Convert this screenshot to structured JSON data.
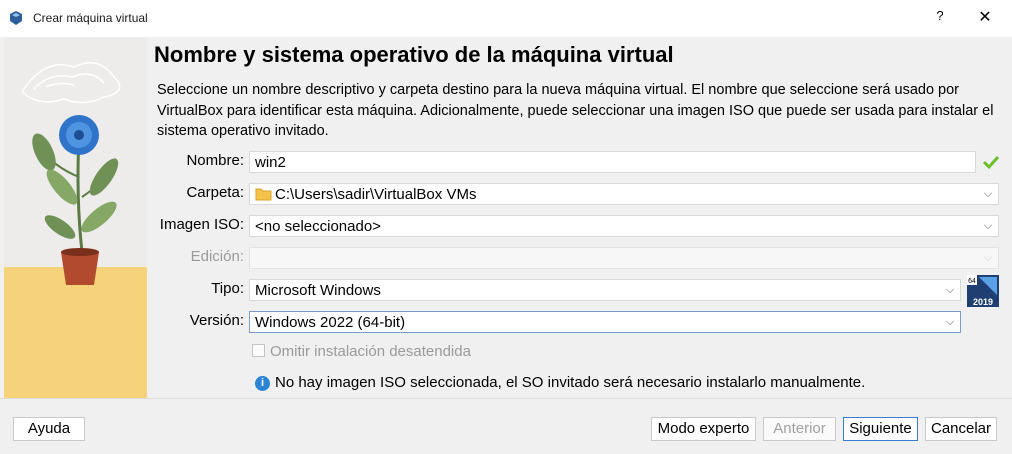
{
  "window": {
    "title": "Crear máquina virtual",
    "help": "?",
    "close": "✕"
  },
  "heading": "Nombre y sistema operativo de la máquina virtual",
  "description": "Seleccione un nombre descriptivo y carpeta destino para la nueva máquina virtual. El nombre que seleccione será usado por VirtualBox para identificar esta máquina. Adicionalmente, puede seleccionar una imagen ISO que puede ser usada para instalar el sistema operativo invitado.",
  "form": {
    "name_label": "Nombre:",
    "name_value": "win2",
    "folder_label": "Carpeta:",
    "folder_value": "C:\\Users\\sadir\\VirtualBox VMs",
    "iso_label": "Imagen ISO:",
    "iso_value": "<no seleccionado>",
    "edition_label": "Edición:",
    "edition_value": "",
    "type_label": "Tipo:",
    "type_value": "Microsoft Windows",
    "version_label": "Versión:",
    "version_value": "Windows 2022 (64-bit)",
    "unattended_label": "Omitir instalación desatendida",
    "info_message": "No hay imagen ISO seleccionada, el SO invitado será necesario instalarlo manualmente."
  },
  "os_badge": {
    "top": "64",
    "bottom": "2019"
  },
  "buttons": {
    "help": "Ayuda",
    "expert": "Modo experto",
    "back": "Anterior",
    "next": "Siguiente",
    "cancel": "Cancelar"
  },
  "colors": {
    "accent": "#3b7ad1",
    "valid_check": "#6cbf2a",
    "info": "#2b84d6"
  }
}
